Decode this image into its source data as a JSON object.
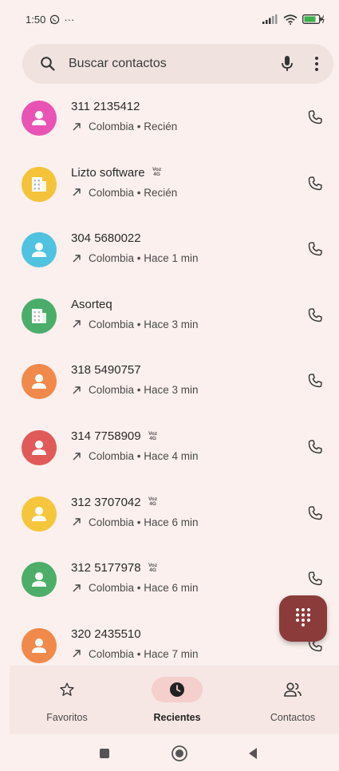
{
  "status_bar": {
    "time": "1:50",
    "extra": "···"
  },
  "search": {
    "placeholder": "Buscar contactos"
  },
  "calls": [
    {
      "name": "311 2135412",
      "volte": false,
      "detail": "Colombia • Recién",
      "avatar_color": "#e953b4",
      "avatar_type": "person"
    },
    {
      "name": "Lizto software",
      "volte": true,
      "detail": "Colombia • Recién",
      "avatar_color": "#f4c33a",
      "avatar_type": "business"
    },
    {
      "name": "304 5680022",
      "volte": false,
      "detail": "Colombia • Hace 1 min",
      "avatar_color": "#4fc3e0",
      "avatar_type": "person"
    },
    {
      "name": "Asorteq",
      "volte": false,
      "detail": "Colombia • Hace 3 min",
      "avatar_color": "#4aae6a",
      "avatar_type": "business"
    },
    {
      "name": "318 5490757",
      "volte": false,
      "detail": "Colombia • Hace 3 min",
      "avatar_color": "#f0894a",
      "avatar_type": "person"
    },
    {
      "name": "314 7758909",
      "volte": true,
      "detail": "Colombia • Hace 4 min",
      "avatar_color": "#e05a5a",
      "avatar_type": "person"
    },
    {
      "name": "312 3707042",
      "volte": true,
      "detail": "Colombia • Hace 6 min",
      "avatar_color": "#f5c63c",
      "avatar_type": "person"
    },
    {
      "name": "312 5177978",
      "volte": true,
      "detail": "Colombia • Hace 6 min",
      "avatar_color": "#4cae68",
      "avatar_type": "person"
    },
    {
      "name": "320 2435510",
      "volte": false,
      "detail": "Colombia • Hace 7 min",
      "avatar_color": "#f0894a",
      "avatar_type": "person"
    }
  ],
  "volte_label": {
    "line1": "Voz",
    "line2": "4G"
  },
  "nav": {
    "favorites": "Favoritos",
    "recents": "Recientes",
    "contacts": "Contactos"
  },
  "colors": {
    "background": "#fbf0ee",
    "fab": "#8a3b3a",
    "active_pill": "#f4cfcc"
  }
}
